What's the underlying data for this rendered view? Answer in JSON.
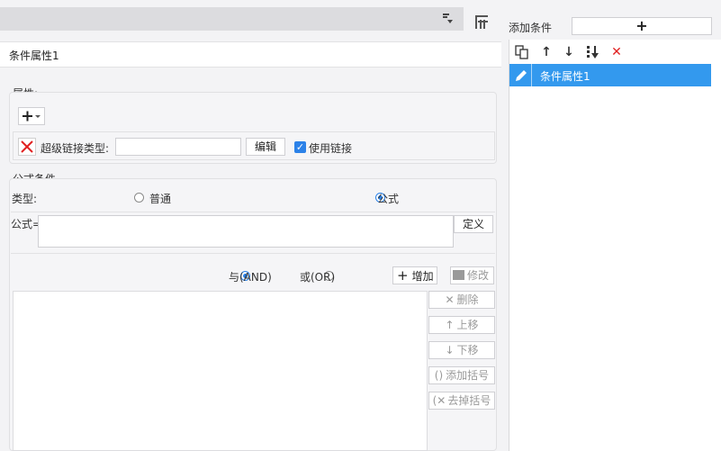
{
  "title": "条件属性1",
  "attributes": {
    "label": "属性:",
    "row": {
      "label": "超级链接类型:",
      "value": "",
      "edit_button": "编辑",
      "use_link_label": "使用链接",
      "use_link_checked": true
    }
  },
  "formula_condition": {
    "label": "公式条件",
    "type_label": "类型:",
    "type_options": [
      {
        "label": "普通",
        "selected": false
      },
      {
        "label": "公式",
        "selected": true
      }
    ],
    "formula_label": "公式=",
    "formula_value": "",
    "define_button": "定义"
  },
  "logic": {
    "options": [
      {
        "label": "与(AND)",
        "selected": true
      },
      {
        "label": "或(OR)",
        "selected": false
      }
    ],
    "add_button": "增加",
    "modify_button": "修改",
    "delete_button": "删除",
    "move_up_button": "上移",
    "move_down_button": "下移",
    "add_bracket_button": "添加括号",
    "remove_bracket_button": "去掉括号"
  },
  "right_panel": {
    "add_condition_label": "添加条件",
    "add_symbol": "+",
    "items": [
      {
        "label": "条件属性1",
        "selected": true
      }
    ]
  },
  "colors": {
    "accent": "#2c82e8",
    "selected_row": "#3399ee",
    "delete_red": "#e02020"
  }
}
